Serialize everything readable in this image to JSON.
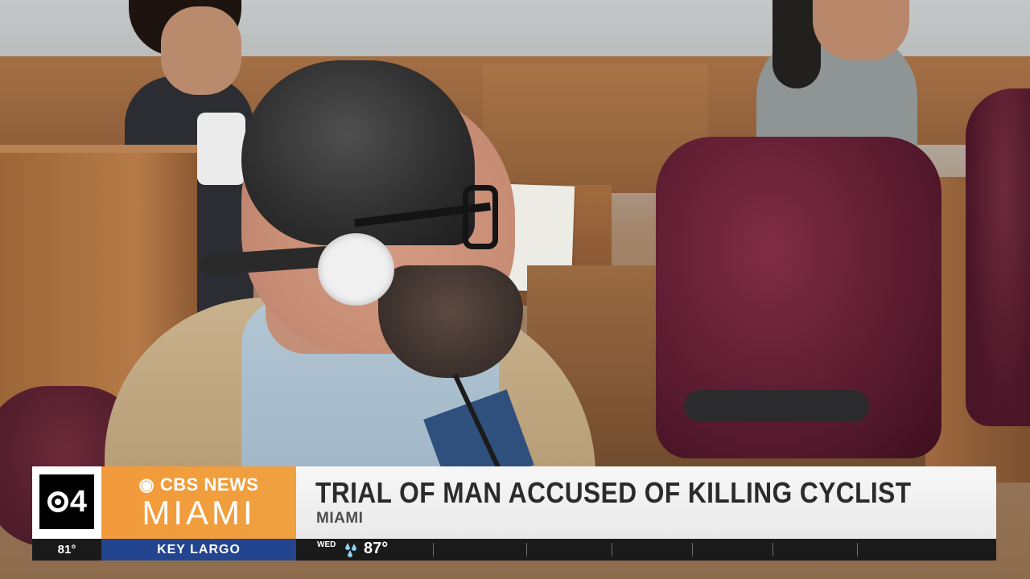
{
  "brand": {
    "station_number": "4",
    "network_line": "CBS NEWS",
    "city_line": "MIAMI",
    "accent_color": "#f29a3b",
    "location_tab_color": "#23458f"
  },
  "lower_third": {
    "headline": "TRIAL OF MAN ACCUSED OF KILLING CYCLIST",
    "subline": "MIAMI"
  },
  "ticker": {
    "current_temp": "81°",
    "location": "KEY LARGO",
    "forecast_day": "WED",
    "forecast_icon": "rain-icon",
    "forecast_temp": "87°"
  }
}
